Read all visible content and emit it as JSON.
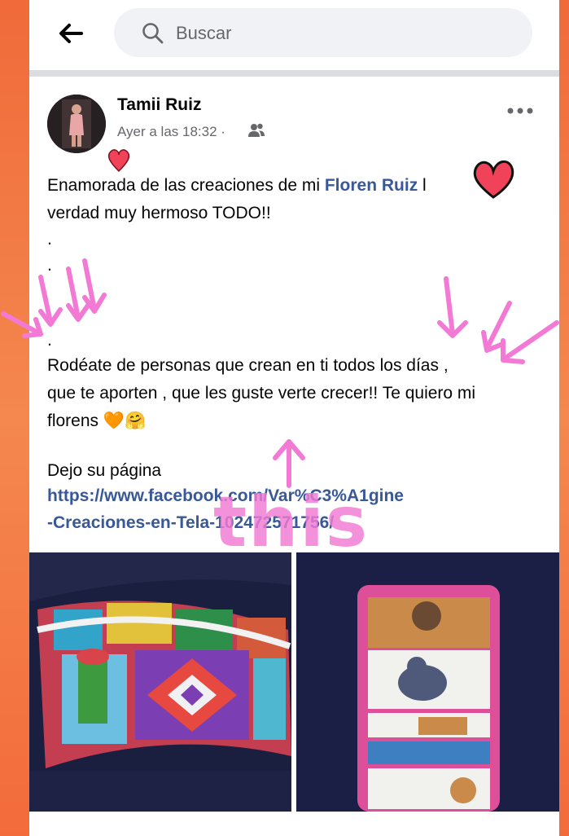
{
  "header": {
    "search_placeholder": "Buscar",
    "back_icon": "arrow-left-icon",
    "search_icon": "search-icon"
  },
  "post": {
    "author": "Tamii Ruiz",
    "time": "Ayer a las 18:32",
    "separator": "·",
    "audience_icon": "friends-icon",
    "more_icon": "more-horizontal-icon",
    "line1_before": "Enamorada de las creaciones de mi ",
    "line1_mention": "Floren Ruiz",
    "line1_after": " l",
    "line2": "verdad muy hermoso TODO!!",
    "dot1": ".",
    "dot2": ".",
    "dot3": ".",
    "line3": "Rodéate de personas que crean en ti todos los días ,",
    "line4": "que te aporten , que les guste verte crecer!! Te quiero mi",
    "line5": "florens 🧡🤗",
    "line6": "Dejo su página",
    "link1": "https://www.facebook.com/Var%C3%A1gine",
    "link2": "-Creaciones-en-Tela-102472571756/"
  },
  "overlay": {
    "annotation": "this"
  },
  "colors": {
    "link": "#385898",
    "annotation": "#f27ad4",
    "heart": "#f0435a"
  }
}
